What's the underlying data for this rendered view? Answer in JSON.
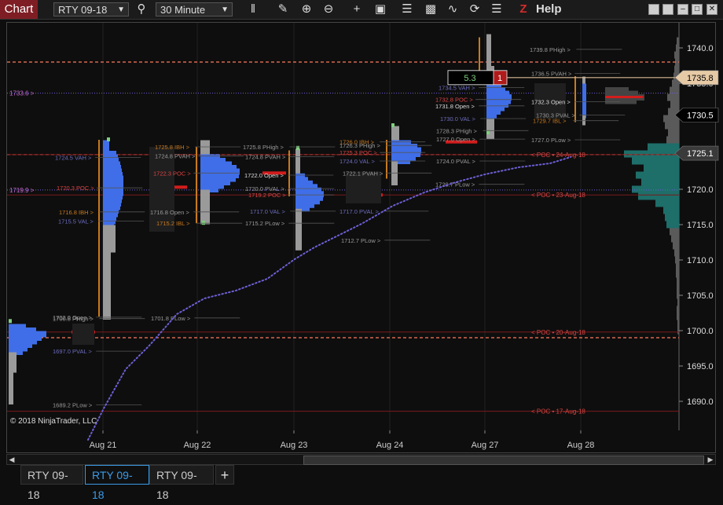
{
  "toolbar": {
    "app_title": "Chart",
    "instrument": "RTY 09-18",
    "timeframe": "30 Minute",
    "help": "Help",
    "icons": [
      "search-icon",
      "bar-type-icon",
      "pencil-icon",
      "zoom-in-icon",
      "zoom-out-icon",
      "crosshair-icon",
      "data-box-icon",
      "strategy-icon",
      "indicators-icon",
      "drawing-tools-icon",
      "refresh-icon",
      "properties-icon",
      "z-icon"
    ],
    "window_buttons": [
      "restore",
      "minimize",
      "maximize",
      "close"
    ]
  },
  "tabs": [
    {
      "label": "RTY 09-18",
      "active": false
    },
    {
      "label": "RTY 09-18",
      "active": true
    },
    {
      "label": "RTY 09-18",
      "active": false
    }
  ],
  "colors": {
    "bg": "#0e0e0e",
    "profile_blue": "#3f6ee8",
    "profile_gray": "#9a9a9a",
    "poc_red": "#d31c1c",
    "ib_orange": "#c87a1e",
    "vwap_dot": "#6c5fd6",
    "ref_line": "#ff7a5c",
    "volume_teal": "#1e6e6a"
  },
  "chart_data": {
    "type": "market-profile",
    "instrument": "RTY 09-18",
    "interval": "30 Minute",
    "copyright": "© 2018 NinjaTrader, LLC",
    "y_range": [
      1684.8,
      1743.0
    ],
    "y_ticks": [
      1690.0,
      1695.0,
      1700.0,
      1705.0,
      1710.0,
      1715.0,
      1720.0,
      1725.0,
      1730.0,
      1735.0,
      1740.0
    ],
    "x_ticks": [
      "Aug 21",
      "Aug 22",
      "Aug 23",
      "Aug 24",
      "Aug 27",
      "Aug 28"
    ],
    "price_markers": [
      {
        "value": 1735.8,
        "style": "tan"
      },
      {
        "value": 1730.5,
        "style": "dark"
      },
      {
        "value": 1725.1,
        "style": "gray"
      }
    ],
    "reference_lines": [
      {
        "value": 1738.0
      },
      {
        "value": 1724.9
      },
      {
        "value": 1699.0
      }
    ],
    "left_labels": [
      {
        "text": "1733.6 >",
        "value": 1733.6,
        "color": "#c96ad6"
      },
      {
        "text": "1719.9 >",
        "value": 1719.9,
        "color": "#c96ad6"
      }
    ],
    "order_box": {
      "value": "5.3",
      "count": "1",
      "price": 1735.8
    },
    "poc_lines": [
      {
        "label": "< POC • 24-Aug-18",
        "value": 1724.9,
        "color": "#d44"
      },
      {
        "label": "< POC • 23-Aug-18",
        "value": 1719.2,
        "color": "#d44"
      },
      {
        "label": "< POC • 20-Aug-18",
        "value": 1699.8,
        "color": "#d44"
      },
      {
        "label": "< POC • 17-Aug-18",
        "value": 1688.6,
        "color": "#d44"
      }
    ],
    "sessions": [
      {
        "name": "Aug 20",
        "high": 1700.8,
        "low": 1689.0,
        "vah": 1700.3,
        "val": 1697.0,
        "poc": 1699.8,
        "open": 1702.0,
        "ib_high": null,
        "ib_low": null,
        "gray_low": 1689.2,
        "labels": [
          {
            "text": "1700.8 PHigh >",
            "value": 1701.7,
            "color": "#9a9a9a"
          },
          {
            "text": "1702.0 Open >",
            "value": 1701.9,
            "color": "#9a9a9a"
          },
          {
            "text": "1697.0 PVAL >",
            "value": 1697.1,
            "color": "#6c6cbe"
          },
          {
            "text": "1689.2 PLow >",
            "value": 1689.5,
            "color": "#9a9a9a"
          }
        ]
      },
      {
        "name": "Aug 21",
        "high": 1727.0,
        "low": 1702.0,
        "vah": 1724.5,
        "val": 1715.5,
        "poc": 1720.3,
        "ib_high": 1716.8,
        "ib_low": null,
        "gray_low": 1701.8,
        "labels": [
          {
            "text": "1724.5 VAH >",
            "value": 1724.5,
            "color": "#6c6cbe"
          },
          {
            "text": "1720.3 POC >",
            "value": 1720.2,
            "color": "#d44"
          },
          {
            "text": "1716.8 IBH >",
            "value": 1716.8,
            "color": "#c87a1e"
          },
          {
            "text": "1715.5 VAL >",
            "value": 1715.5,
            "color": "#6c6cbe"
          },
          {
            "text": "1701.8 PLow >",
            "value": 1701.8,
            "color": "#9a9a9a"
          }
        ]
      },
      {
        "name": "Aug 22",
        "high": 1726.8,
        "low": 1715.0,
        "vah": 1724.9,
        "val": 1715.4,
        "poc": 1722.3,
        "ib_high": 1725.8,
        "ib_low": 1715.2,
        "open": 1716.8,
        "labels": [
          {
            "text": "1725.8 IBH >",
            "value": 1726.0,
            "color": "#c87a1e"
          },
          {
            "text": "1724.8 PVAH >",
            "value": 1724.7,
            "color": "#9a9a9a"
          },
          {
            "text": "1722.3 POC >",
            "value": 1722.3,
            "color": "#d44"
          },
          {
            "text": "1716.8 Open >",
            "value": 1716.8,
            "color": "#9a9a9a"
          },
          {
            "text": "1715.2 IBL >",
            "value": 1715.2,
            "color": "#c87a1e"
          },
          {
            "text": "1725.8 PHigh >",
            "value": 1726.0,
            "color": "#9a9a9a"
          },
          {
            "text": "1724.8 PVAH >",
            "value": 1724.6,
            "color": "#9a9a9a"
          },
          {
            "text": "1722.0 Open >",
            "value": 1722.0,
            "color": "#ddd"
          },
          {
            "text": "1720.0 PVAL >",
            "value": 1720.1,
            "color": "#9a9a9a"
          },
          {
            "text": "1719.2 POC >",
            "value": 1719.2,
            "color": "#d44"
          },
          {
            "text": "1717.0 VAL >",
            "value": 1716.9,
            "color": "#6c6cbe"
          },
          {
            "text": "1715.2 PLow >",
            "value": 1715.2,
            "color": "#9a9a9a"
          }
        ]
      },
      {
        "name": "Aug 23",
        "high": 1725.3,
        "low": 1711.5,
        "vah": 1722.1,
        "val": 1717.0,
        "poc": 1719.2,
        "labels": [
          {
            "text": "1722.1 PVAH >",
            "value": 1722.3,
            "color": "#9a9a9a"
          },
          {
            "text": "1717.0 PVAL >",
            "value": 1716.9,
            "color": "#6c6cbe"
          },
          {
            "text": "1712.7 PLow >",
            "value": 1712.8,
            "color": "#9a9a9a"
          },
          {
            "text": "1726.0 IBH >",
            "value": 1726.7,
            "color": "#c87a1e"
          },
          {
            "text": "1726.3 PHigh >",
            "value": 1726.2,
            "color": "#9a9a9a"
          },
          {
            "text": "1725.3 POC >",
            "value": 1725.2,
            "color": "#d44"
          },
          {
            "text": "1724.0 VAL >",
            "value": 1724.0,
            "color": "#6c6cbe"
          },
          {
            "text": "1720.7 PLow >",
            "value": 1720.7,
            "color": "#9a9a9a"
          }
        ]
      },
      {
        "name": "Aug 24",
        "high": 1728.7,
        "low": 1720.8,
        "vah": 1726.5,
        "val": 1724.0,
        "poc": 1724.9,
        "labels": [
          {
            "text": "1728.3 PHigh >",
            "value": 1728.3,
            "color": "#9a9a9a"
          },
          {
            "text": "1727.0 Open >",
            "value": 1727.1,
            "color": "#9a9a9a"
          },
          {
            "text": "1724.0 PVAL >",
            "value": 1724.0,
            "color": "#9a9a9a"
          }
        ]
      },
      {
        "name": "Aug 27",
        "high": 1741.5,
        "low": 1727.5,
        "vah": 1734.5,
        "val": 1730.0,
        "poc": 1732.8,
        "open": 1731.8,
        "labels": [
          {
            "text": "1739.8 PHigh >",
            "value": 1739.8,
            "color": "#9a9a9a"
          },
          {
            "text": "1736.5 PVAH >",
            "value": 1736.4,
            "color": "#9a9a9a"
          },
          {
            "text": "1734.5 VAH >",
            "value": 1734.4,
            "color": "#6c6cbe"
          },
          {
            "text": "1732.8 POC >",
            "value": 1732.7,
            "color": "#d44"
          },
          {
            "text": "1731.8 Open >",
            "value": 1731.8,
            "color": "#ddd"
          },
          {
            "text": "1730.0 VAL >",
            "value": 1730.0,
            "color": "#6c6cbe"
          },
          {
            "text": "1732.3 Open >",
            "value": 1732.4,
            "color": "#ddd"
          },
          {
            "text": "1730.3 PVAL >",
            "value": 1730.5,
            "color": "#9a9a9a"
          },
          {
            "text": "1729.7 IBL >",
            "value": 1729.7,
            "color": "#c87a1e"
          },
          {
            "text": "1727.0 PLow >",
            "value": 1727.0,
            "color": "#9a9a9a"
          }
        ]
      }
    ],
    "vwap": {
      "style": "dotted",
      "color": "#6c5fd6"
    }
  }
}
